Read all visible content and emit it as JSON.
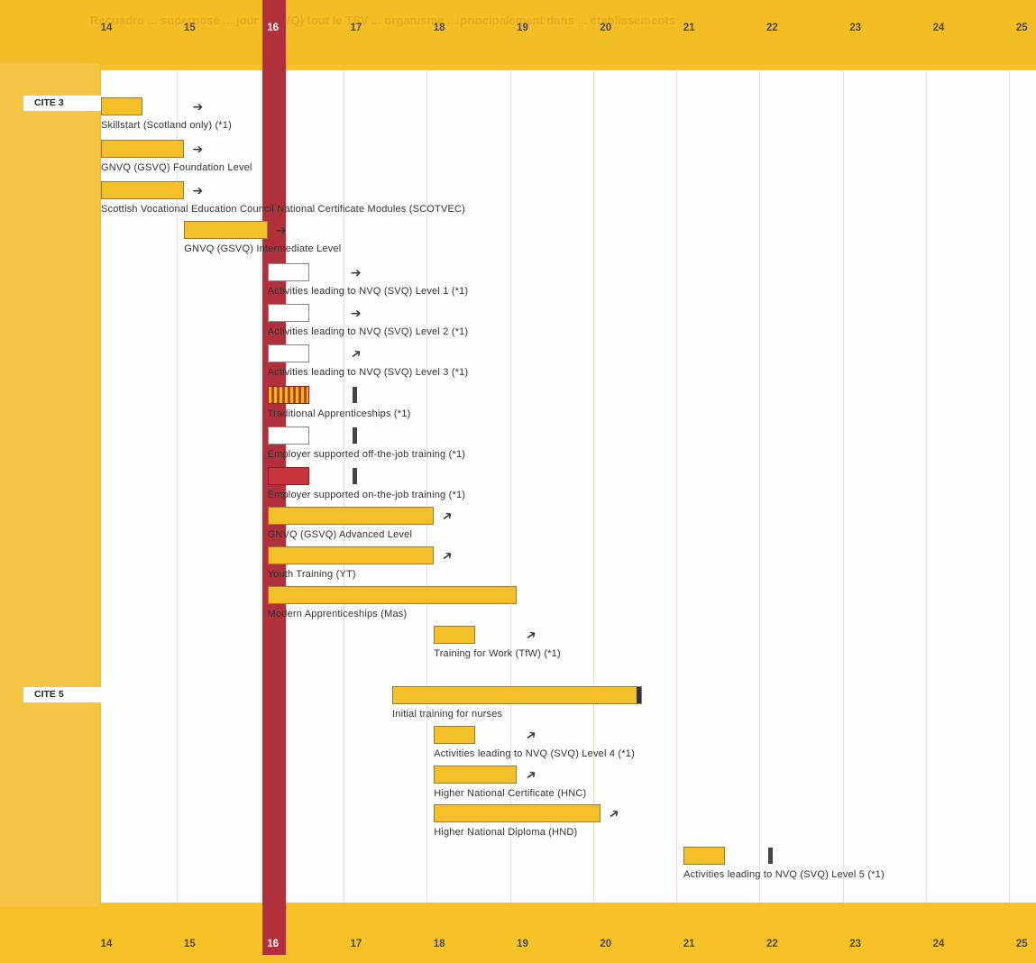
{
  "axis_ticks": [
    "14",
    "15",
    "16",
    "17",
    "18",
    "19",
    "20",
    "21",
    "22",
    "23",
    "24",
    "25"
  ],
  "cite_labels": {
    "cite3": "CITE 3",
    "cite5": "CITE 5"
  },
  "ghost_text": "Recuadro ... superposé ... jour (GNVQ) tout le TSV ... organisme ... principalement dans ... établissements",
  "colors": {
    "yellow": "#f4c02a",
    "red": "#c9353c",
    "highlight_column": "#b0313b",
    "page": "#fdfdfc"
  },
  "programmes": [
    {
      "label": "Skillstart (Scotland only) (*1)",
      "style": "yellow",
      "start": 14,
      "end": 14.5,
      "marker": "arrow",
      "marker_at": 15.1
    },
    {
      "label": "GNVQ (GSVQ) Foundation Level",
      "style": "yellow",
      "start": 14,
      "end": 15,
      "marker": "arrow",
      "marker_at": 15.1
    },
    {
      "label": "Scottish Vocational Education Council National Certificate Modules (SCOTVEC)",
      "style": "yellow",
      "start": 14,
      "end": 15,
      "marker": "arrow",
      "marker_at": 15.1
    },
    {
      "label": "GNVQ (GSVQ) Intermediate Level",
      "style": "yellow",
      "start": 15,
      "end": 16,
      "marker": "arrow",
      "marker_at": 16.1
    },
    {
      "label": "Activities leading to NVQ (SVQ) Level 1 (*1)",
      "style": "white",
      "start": 16,
      "end": 16.5,
      "marker": "arrow",
      "marker_at": 17
    },
    {
      "label": "Activities leading to NVQ (SVQ) Level 2 (*1)",
      "style": "white",
      "start": 16,
      "end": 16.5,
      "marker": "arrow",
      "marker_at": 17
    },
    {
      "label": "Activities leading to NVQ (SVQ) Level 3 (*1)",
      "style": "white",
      "start": 16,
      "end": 16.5,
      "marker": "arrow-up",
      "marker_at": 17
    },
    {
      "label": "Traditional Apprenticeships (*1)",
      "style": "stripe",
      "start": 16,
      "end": 16.5,
      "marker": "stop",
      "marker_at": 17
    },
    {
      "label": "Employer supported off-the-job training (*1)",
      "style": "white",
      "start": 16,
      "end": 16.5,
      "marker": "stop",
      "marker_at": 17
    },
    {
      "label": "Employer supported on-the-job training (*1)",
      "style": "red",
      "start": 16,
      "end": 16.5,
      "marker": "stop",
      "marker_at": 17
    },
    {
      "label": "GNVQ (GSVQ) Advanced Level",
      "style": "yellow",
      "start": 16,
      "end": 18,
      "marker": "arrow-up",
      "marker_at": 18.1
    },
    {
      "label": "Youth Training (YT)",
      "style": "yellow",
      "start": 16,
      "end": 18,
      "marker": "arrow-up",
      "marker_at": 18.1
    },
    {
      "label": "Modern Apprenticeships (Mas)",
      "style": "yellow",
      "start": 16,
      "end": 19,
      "marker": "none",
      "marker_at": null
    },
    {
      "label": "Training for Work (TfW) (*1)",
      "style": "yellow",
      "start": 18,
      "end": 18.5,
      "marker": "arrow-up",
      "marker_at": 19.1
    },
    {
      "label": "Initial training for nurses",
      "style": "yellow",
      "start": 17.5,
      "end": 20.5,
      "marker": "endcap",
      "marker_at": null
    },
    {
      "label": "Activities leading to NVQ (SVQ) Level 4 (*1)",
      "style": "yellow",
      "start": 18,
      "end": 18.5,
      "marker": "arrow-up",
      "marker_at": 19.1
    },
    {
      "label": "Higher National Certificate (HNC)",
      "style": "yellow",
      "start": 18,
      "end": 19,
      "marker": "arrow-up",
      "marker_at": 19.1
    },
    {
      "label": "Higher National Diploma (HND)",
      "style": "yellow",
      "start": 18,
      "end": 20,
      "marker": "arrow-up",
      "marker_at": 20.1
    },
    {
      "label": "Activities leading to NVQ (SVQ) Level 5 (*1)",
      "style": "yellow",
      "start": 21,
      "end": 21.5,
      "marker": "stop",
      "marker_at": 22
    }
  ]
}
